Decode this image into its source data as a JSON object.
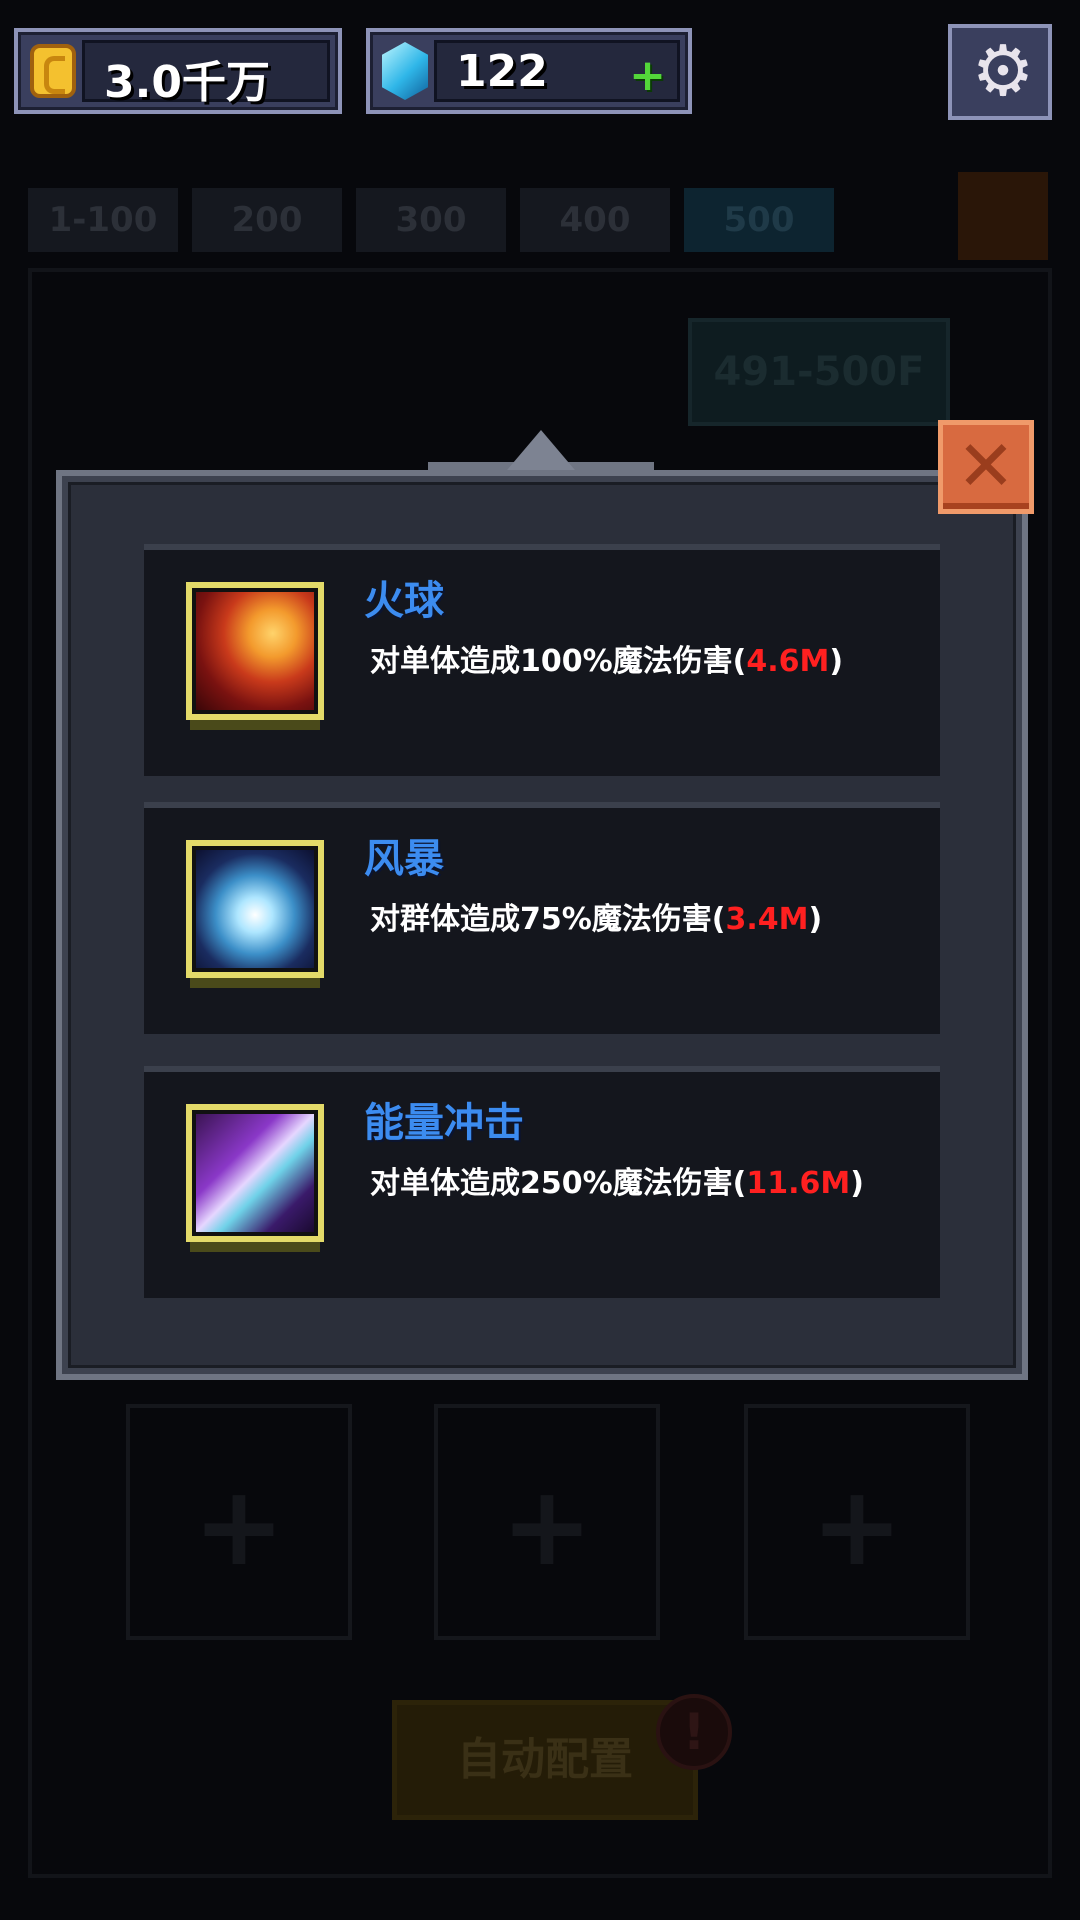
{
  "resources": {
    "gold": "3.0千万",
    "gems": "122",
    "gems_add_label": "+"
  },
  "floor_tabs": [
    {
      "label": "1-100",
      "active": false
    },
    {
      "label": "200",
      "active": false
    },
    {
      "label": "300",
      "active": false
    },
    {
      "label": "400",
      "active": false
    },
    {
      "label": "500",
      "active": true
    }
  ],
  "floor_range": "491-500F",
  "auto_button": {
    "label": "自动配置",
    "alert": "!"
  },
  "slots": [
    {
      "plus": "+"
    },
    {
      "plus": "+"
    },
    {
      "plus": "+"
    }
  ],
  "modal": {
    "close_label": "✕",
    "skills": [
      {
        "name": "火球",
        "desc_prefix": "对单体造成",
        "percent": "100%",
        "desc_suffix": "魔法伤害(",
        "damage": "4.6M",
        "close_paren": ")",
        "icon": "fireball-icon"
      },
      {
        "name": "风暴",
        "desc_prefix": "对群体造成",
        "percent": "75%",
        "desc_suffix": "魔法伤害(",
        "damage": "3.4M",
        "close_paren": ")",
        "icon": "storm-icon"
      },
      {
        "name": "能量冲击",
        "desc_prefix": "对单体造成",
        "percent": "250%",
        "desc_suffix": "魔法伤害(",
        "damage": "11.6M",
        "close_paren": ")",
        "icon": "energy-strike-icon"
      }
    ]
  },
  "colors": {
    "skill_name": "#3c8cf0",
    "damage_value": "#ff2020",
    "icon_frame": "#e3da69",
    "close_button": "#d86a40"
  }
}
